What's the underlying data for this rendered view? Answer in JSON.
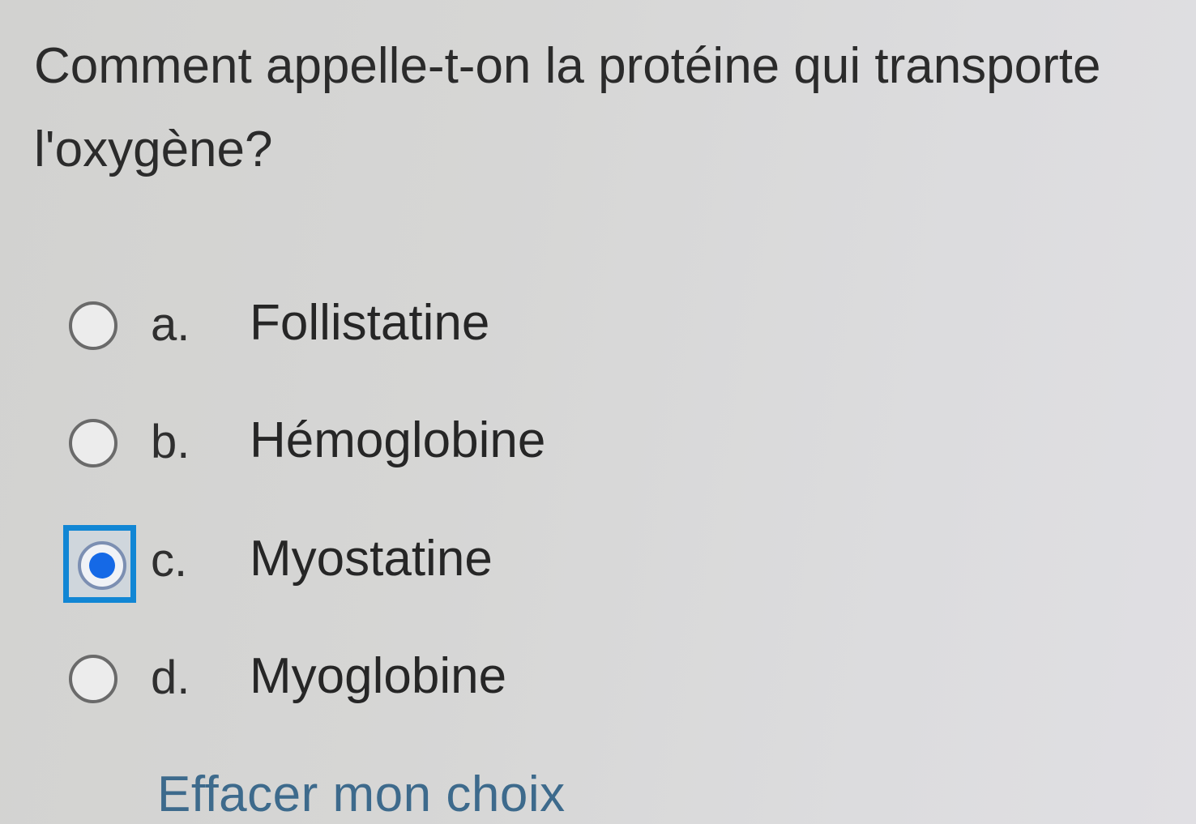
{
  "question": {
    "line1": "Comment appelle-t-on la protéine qui transporte",
    "line2": "l'oxygène?"
  },
  "options": [
    {
      "letter": "a.",
      "label": "Follistatine",
      "selected": false
    },
    {
      "letter": "b.",
      "label": "Hémoglobine",
      "selected": false
    },
    {
      "letter": "c.",
      "label": "Myostatine",
      "selected": true
    },
    {
      "letter": "d.",
      "label": "Myoglobine",
      "selected": false
    }
  ],
  "clear_choice_label": "Effacer mon choix",
  "colors": {
    "selected_dot": "#1569e6",
    "focus_ring": "#1186d4",
    "link": "#3d6a8c"
  }
}
